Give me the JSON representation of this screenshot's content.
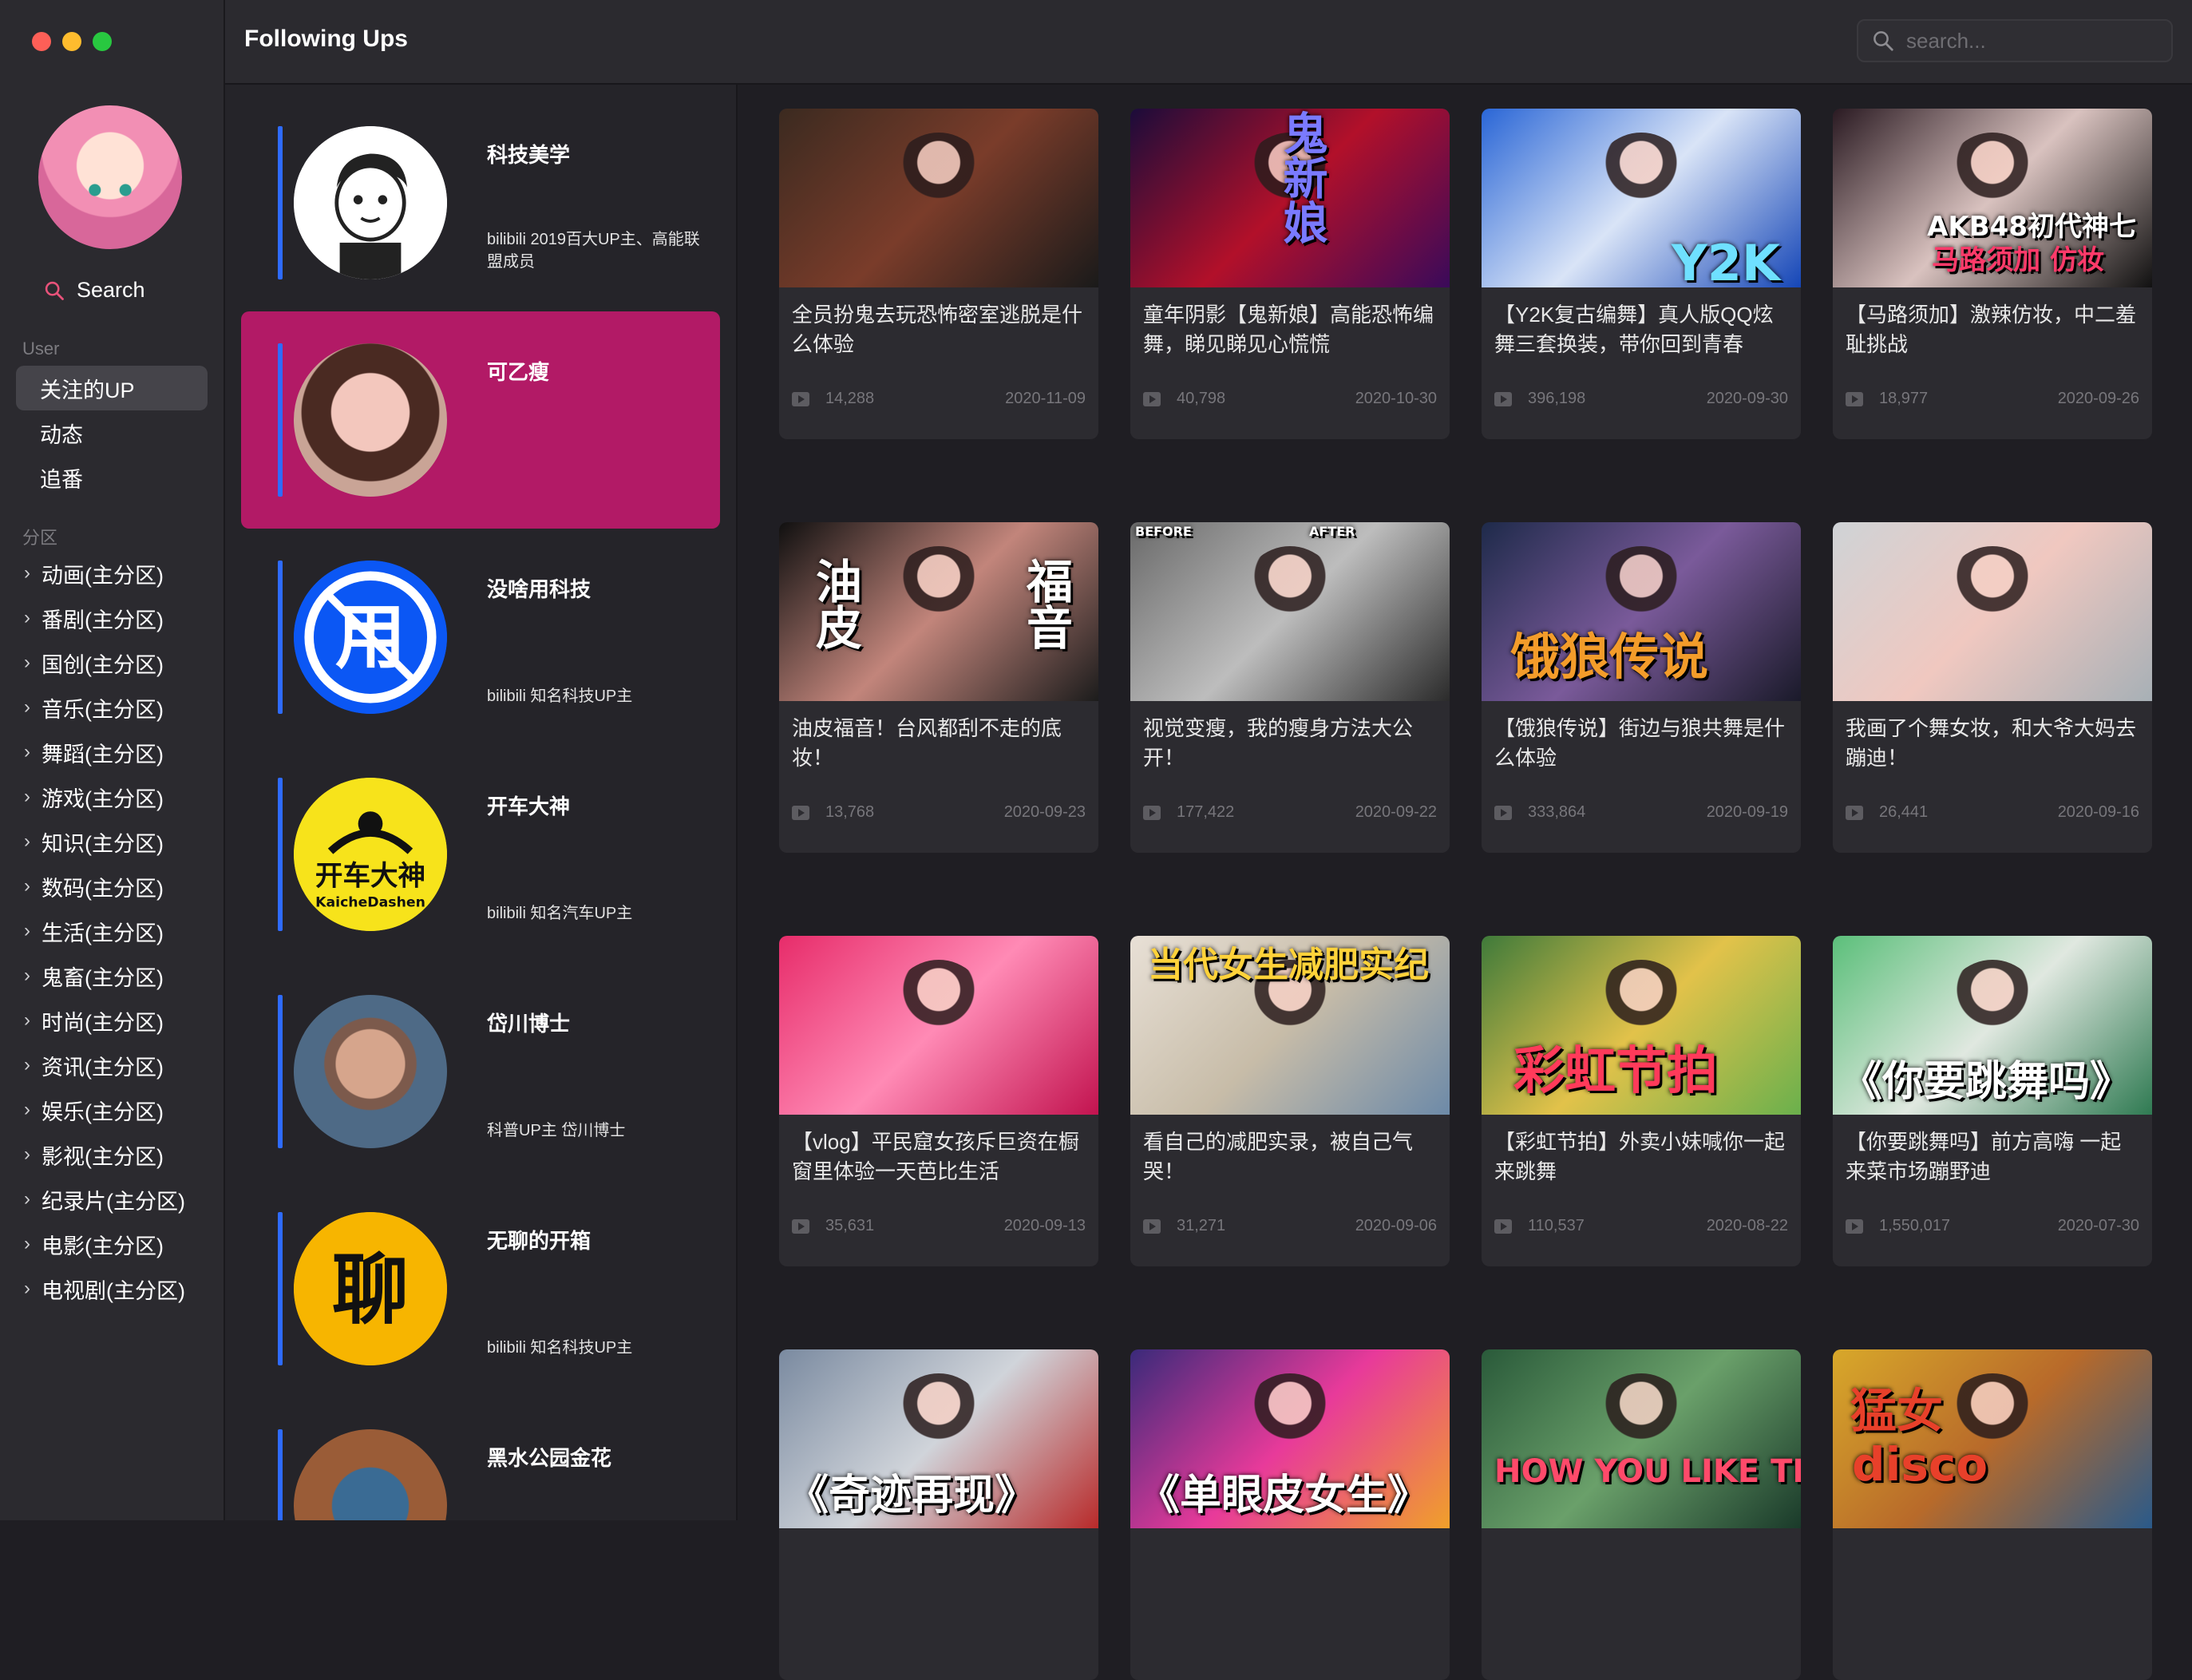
{
  "window": {
    "title": "Following Ups"
  },
  "header": {
    "search_placeholder": "search..."
  },
  "sidebar": {
    "search_label": "Search",
    "user_section": "User",
    "user_items": [
      "关注的UP",
      "动态",
      "追番"
    ],
    "category_section": "分区",
    "categories": [
      "动画(主分区)",
      "番剧(主分区)",
      "国创(主分区)",
      "音乐(主分区)",
      "舞蹈(主分区)",
      "游戏(主分区)",
      "知识(主分区)",
      "数码(主分区)",
      "生活(主分区)",
      "鬼畜(主分区)",
      "时尚(主分区)",
      "资讯(主分区)",
      "娱乐(主分区)",
      "影视(主分区)",
      "纪录片(主分区)",
      "电影(主分区)",
      "电视剧(主分区)"
    ]
  },
  "ups": [
    {
      "name": "科技美学",
      "desc": "bilibili 2019百大UP主、高能联盟成员",
      "active": false
    },
    {
      "name": "可乙瘦",
      "desc": "",
      "active": true
    },
    {
      "name": "没啥用科技",
      "desc": "bilibili 知名科技UP主",
      "active": false,
      "logo_text": "用"
    },
    {
      "name": "开车大神",
      "desc": "bilibili 知名汽车UP主",
      "active": false,
      "logo_text": "开车大神",
      "logo_sub": "KaicheDashen"
    },
    {
      "name": "岱川博士",
      "desc": "科普UP主 岱川博士",
      "active": false
    },
    {
      "name": "无聊的开箱",
      "desc": "bilibili 知名科技UP主",
      "active": false,
      "logo_text": "聊"
    },
    {
      "name": "黑水公园金花",
      "desc": "",
      "active": false
    }
  ],
  "videos": [
    {
      "title": "全员扮鬼去玩恐怖密室逃脱是什么体验",
      "views": "14,288",
      "date": "2020-11-09",
      "overlay": "",
      "bg": [
        "#3b2a20",
        "#7a3c2a",
        "#1a1a1a"
      ]
    },
    {
      "title": "童年阴影【鬼新娘】高能恐怖编舞，睇见睇见心慌慌",
      "views": "40,798",
      "date": "2020-10-30",
      "overlay": "鬼新娘",
      "bg": [
        "#1b0c3a",
        "#b2102a",
        "#3a0a5a"
      ]
    },
    {
      "title": "【Y2K复古编舞】真人版QQ炫舞三套换装，带你回到青春",
      "views": "396,198",
      "date": "2020-09-30",
      "overlay": "Y2K",
      "bg": [
        "#2a66d6",
        "#d9e4f7",
        "#1546b7"
      ]
    },
    {
      "title": "【马路须加】激辣仿妆，中二羞耻挑战",
      "views": "18,977",
      "date": "2020-09-26",
      "overlay": "AKB48初代神七",
      "overlay2": "马路须加 仿妆",
      "bg": [
        "#2a1a22",
        "#d9c2bf",
        "#111"
      ]
    },
    {
      "title": "油皮福音！台风都刮不走的底妆！",
      "views": "13,768",
      "date": "2020-09-23",
      "overlay": "油皮",
      "overlay2": "福音",
      "bg": [
        "#101010",
        "#c2857b",
        "#1c1c1c"
      ]
    },
    {
      "title": "视觉变瘦，我的瘦身方法大公开！",
      "views": "177,422",
      "date": "2020-09-22",
      "overlay": "BEFORE",
      "overlay2": "AFTER",
      "bg": [
        "#6a6a6a",
        "#bdbdbd",
        "#2b2b2b"
      ]
    },
    {
      "title": "【饿狼传说】街边与狼共舞是什么体验",
      "views": "333,864",
      "date": "2020-09-19",
      "overlay": "饿狼传说",
      "bg": [
        "#1e2a4a",
        "#7a5a9a",
        "#1a1a2a"
      ]
    },
    {
      "title": "我画了个舞女妆，和大爷大妈去蹦迪！",
      "views": "26,441",
      "date": "2020-09-16",
      "overlay": "",
      "bg": [
        "#cfd3d6",
        "#f0c8c0",
        "#a7b0b6"
      ]
    },
    {
      "title": "【vlog】平民窟女孩斥巨资在橱窗里体验一天芭比生活",
      "views": "35,631",
      "date": "2020-09-13",
      "overlay": "",
      "bg": [
        "#e72c6a",
        "#ff8ab5",
        "#c2134f"
      ]
    },
    {
      "title": "看自己的减肥实录，被自己气哭！",
      "views": "31,271",
      "date": "2020-09-06",
      "overlay": "当代女生减肥实纪",
      "bg": [
        "#e8e0d6",
        "#c7bca8",
        "#6d8aa8"
      ]
    },
    {
      "title": "【彩虹节拍】外卖小妹喊你一起来跳舞",
      "views": "110,537",
      "date": "2020-08-22",
      "overlay": "彩虹节拍",
      "bg": [
        "#3f7a3a",
        "#e2c24a",
        "#6ab04c"
      ]
    },
    {
      "title": "【你要跳舞吗】前方高嗨 一起来菜市场蹦野迪",
      "views": "1,550,017",
      "date": "2020-07-30",
      "overlay": "《你要跳舞吗》",
      "bg": [
        "#5bbf7a",
        "#e0e8e0",
        "#2f7a52"
      ]
    },
    {
      "title": "",
      "views": "",
      "date": "",
      "overlay": "《奇迹再现》",
      "bg": [
        "#7a8aa0",
        "#d0d4da",
        "#b82a2a"
      ]
    },
    {
      "title": "",
      "views": "",
      "date": "",
      "overlay": "《单眼皮女生》",
      "bg": [
        "#3a2a7a",
        "#e83a9a",
        "#f0a02a"
      ]
    },
    {
      "title": "",
      "views": "",
      "date": "",
      "overlay": "HOW YOU LIKE THAT",
      "bg": [
        "#2a5a3a",
        "#6aa06a",
        "#1a3a2a"
      ]
    },
    {
      "title": "",
      "views": "",
      "date": "",
      "overlay": "猛女",
      "overlay2": "disco",
      "bg": [
        "#d8a82a",
        "#b86a2a",
        "#2a5a8a"
      ]
    }
  ]
}
